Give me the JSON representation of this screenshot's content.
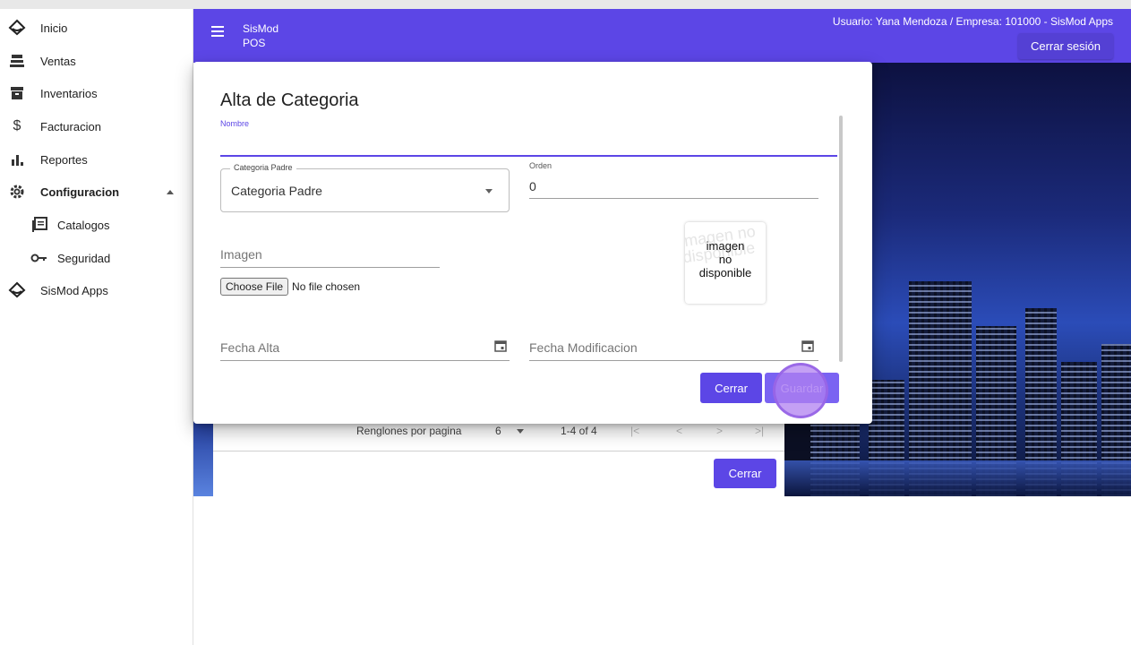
{
  "sidebar": {
    "items": [
      {
        "label": "Inicio",
        "icon": "sismod-logo-icon"
      },
      {
        "label": "Ventas",
        "icon": "cash-register-icon"
      },
      {
        "label": "Inventarios",
        "icon": "archive-icon"
      },
      {
        "label": "Facturacion",
        "icon": "dollar-icon"
      },
      {
        "label": "Reportes",
        "icon": "bar-chart-icon"
      },
      {
        "label": "Configuracion",
        "icon": "gear-icon"
      },
      {
        "label": "Catalogos",
        "icon": "catalog-icon"
      },
      {
        "label": "Seguridad",
        "icon": "key-icon"
      },
      {
        "label": "SisMod Apps",
        "icon": "sismod-logo-icon"
      }
    ]
  },
  "appbar": {
    "title_line1": "SisMod",
    "title_line2": "POS",
    "user_info": "Usuario: Yana Mendoza / Empresa: 101000 - SisMod Apps",
    "logout_label": "Cerrar sesión",
    "color": "#5c46e6"
  },
  "list": {
    "rows_per_page_label": "Renglones por pagina",
    "rows_per_page_value": "6",
    "range": "1-4 of 4",
    "first": "|<",
    "prev": "<",
    "next": ">",
    "last": ">|",
    "close_label": "Cerrar"
  },
  "dialog": {
    "title": "Alta de Categoria",
    "nombre_label": "Nombre",
    "categoria_padre_label": "Categoria Padre",
    "categoria_padre_value": "Categoria Padre",
    "orden_label": "Orden",
    "orden_value": "0",
    "imagen_label": "Imagen",
    "file_button": "Choose File",
    "file_status": "No file chosen",
    "noimage_watermark": "imagen no disponible",
    "noimage_line1": "imagen",
    "noimage_line2": "no",
    "noimage_line3": "disponible",
    "fecha_alta_label": "Fecha Alta",
    "fecha_mod_label": "Fecha Modificacion",
    "close_label": "Cerrar",
    "save_label": "Guardar"
  }
}
